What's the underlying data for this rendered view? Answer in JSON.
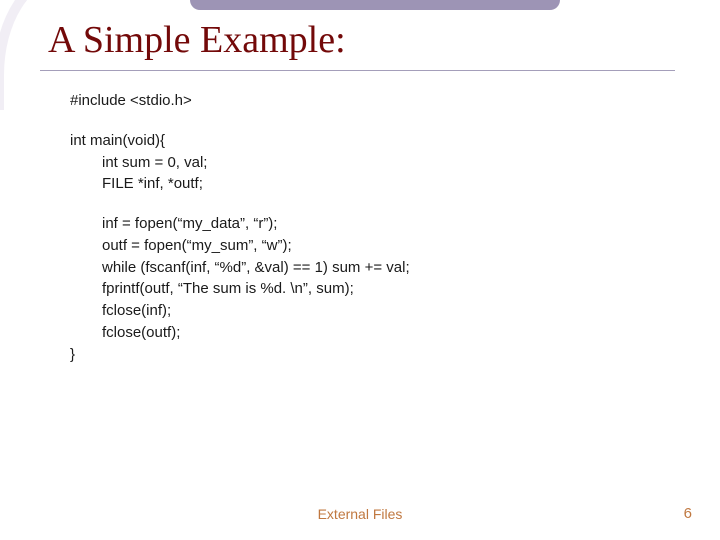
{
  "slide": {
    "title": "A Simple Example:",
    "code": {
      "l1": "#include <stdio.h>",
      "l2": "int main(void){",
      "l3": "int sum = 0, val;",
      "l4": "FILE *inf, *outf;",
      "l5": "inf = fopen(“my_data”, “r”);",
      "l6": "outf = fopen(“my_sum”, “w”);",
      "l7": "while (fscanf(inf, “%d”, &val) == 1) sum += val;",
      "l8": "fprintf(outf, “The sum is %d. \\n”, sum);",
      "l9": "fclose(inf);",
      "l10": "fclose(outf);",
      "l11": "}"
    },
    "footer": "External Files",
    "page_number": "6"
  }
}
